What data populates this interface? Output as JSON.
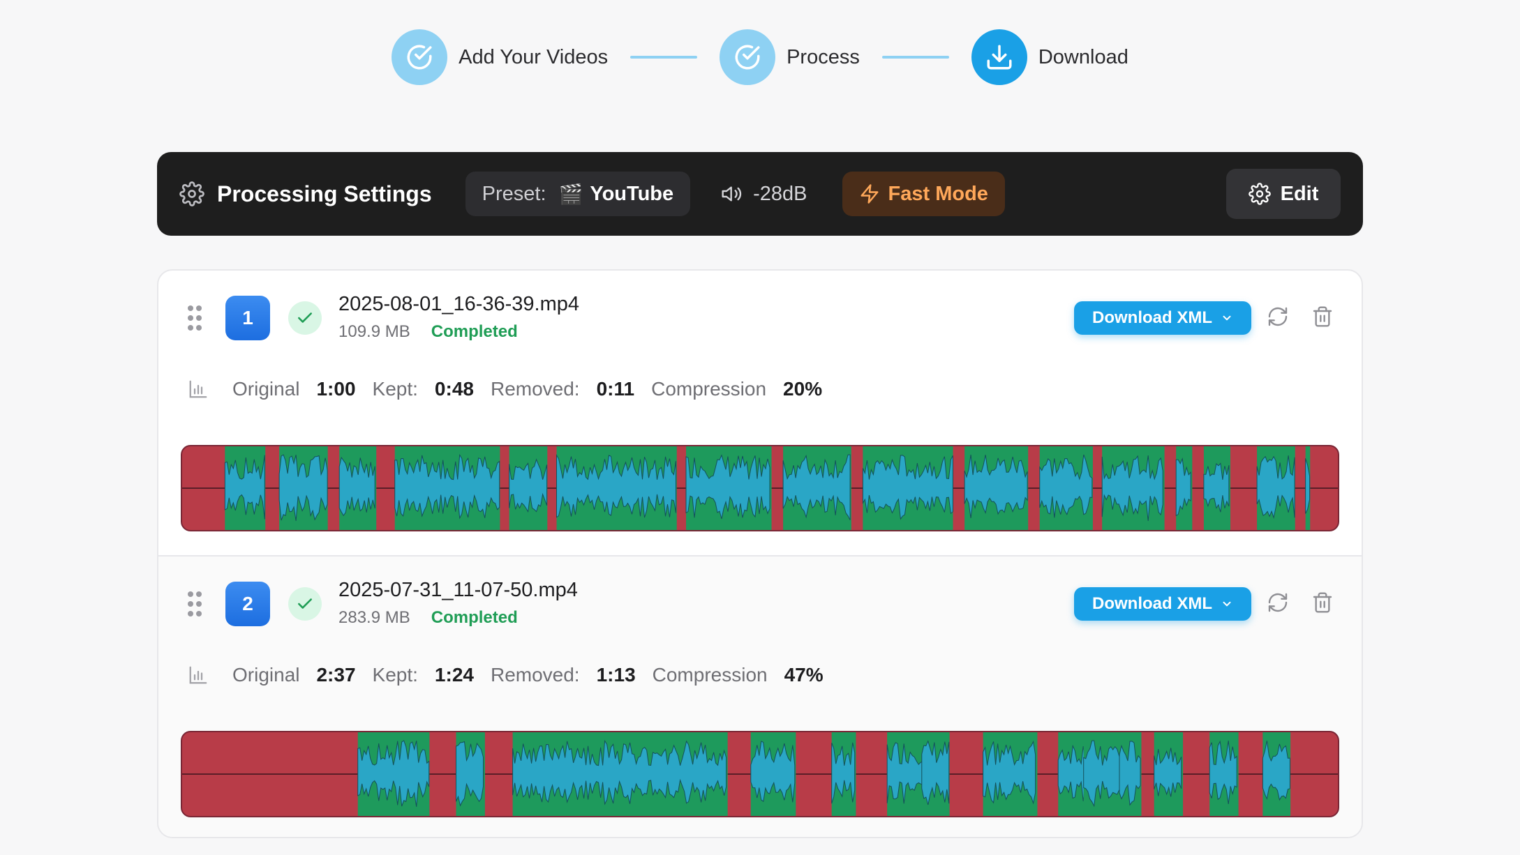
{
  "stepper": {
    "steps": [
      {
        "label": "Add Your Videos",
        "state": "done"
      },
      {
        "label": "Process",
        "state": "done"
      },
      {
        "label": "Download",
        "state": "active"
      }
    ]
  },
  "settings": {
    "title": "Processing Settings",
    "preset_label": "Preset:",
    "preset_icon": "🎬",
    "preset_value": "YouTube",
    "volume": "-28dB",
    "fast_mode": "Fast Mode",
    "edit_label": "Edit"
  },
  "files": [
    {
      "index": "1",
      "name": "2025-08-01_16-36-39.mp4",
      "size": "109.9 MB",
      "status": "Completed",
      "download_label": "Download XML",
      "stats": {
        "original_label": "Original",
        "original": "1:00",
        "kept_label": "Kept:",
        "kept": "0:48",
        "removed_label": "Removed:",
        "removed": "0:11",
        "compression_label": "Compression",
        "compression": "20%"
      },
      "kept_segments": [
        [
          0.037,
          0.072
        ],
        [
          0.084,
          0.126
        ],
        [
          0.136,
          0.168
        ],
        [
          0.184,
          0.275
        ],
        [
          0.283,
          0.316
        ],
        [
          0.324,
          0.428
        ],
        [
          0.436,
          0.51
        ],
        [
          0.52,
          0.579
        ],
        [
          0.589,
          0.667
        ],
        [
          0.677,
          0.732
        ],
        [
          0.742,
          0.788
        ],
        [
          0.796,
          0.85
        ],
        [
          0.86,
          0.874
        ],
        [
          0.884,
          0.907
        ],
        [
          0.93,
          0.963
        ],
        [
          0.972,
          0.976
        ]
      ]
    },
    {
      "index": "2",
      "name": "2025-07-31_11-07-50.mp4",
      "size": "283.9 MB",
      "status": "Completed",
      "download_label": "Download XML",
      "stats": {
        "original_label": "Original",
        "original": "2:37",
        "kept_label": "Kept:",
        "kept": "1:24",
        "removed_label": "Removed:",
        "removed": "1:13",
        "compression_label": "Compression",
        "compression": "47%"
      },
      "kept_segments": [
        [
          0.152,
          0.214
        ],
        [
          0.237,
          0.262
        ],
        [
          0.286,
          0.472
        ],
        [
          0.492,
          0.531
        ],
        [
          0.562,
          0.583
        ],
        [
          0.61,
          0.642
        ],
        [
          0.64,
          0.664
        ],
        [
          0.693,
          0.74
        ],
        [
          0.757,
          0.728
        ],
        [
          0.758,
          0.782
        ],
        [
          0.78,
          0.814
        ],
        [
          0.811,
          0.83
        ],
        [
          0.841,
          0.866
        ],
        [
          0.889,
          0.914
        ],
        [
          0.935,
          0.959
        ]
      ]
    }
  ],
  "colors": {
    "accent": "#1aa0e6",
    "step_done": "#8ed1f3",
    "removed": "#b83c48",
    "kept": "#1e9a5c",
    "wave": "#2aa6c6",
    "status_ok": "#1f9d55",
    "fast_mode": "#ffa85a"
  }
}
